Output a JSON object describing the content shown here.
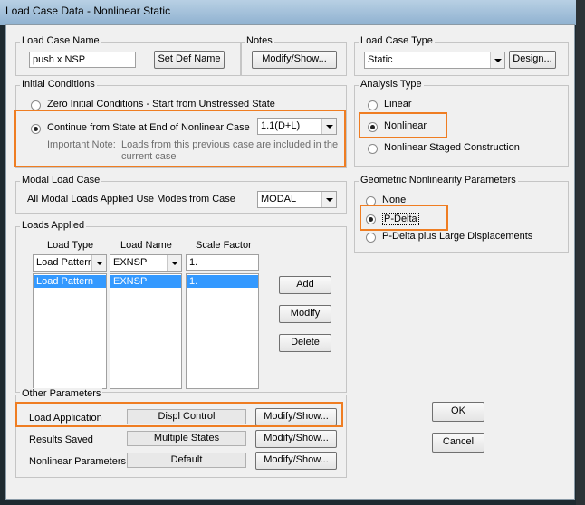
{
  "window": {
    "title": "Load Case Data - Nonlinear Static"
  },
  "load_case_name": {
    "label": "Load Case Name",
    "value": "push x NSP",
    "set_def_button": "Set Def Name"
  },
  "notes": {
    "label": "Notes",
    "button": "Modify/Show..."
  },
  "load_case_type": {
    "label": "Load Case Type",
    "value": "Static",
    "design_button": "Design..."
  },
  "initial_conditions": {
    "label": "Initial Conditions",
    "zero": "Zero Initial Conditions - Start from Unstressed State",
    "continue": "Continue from State at End of Nonlinear Case",
    "continue_case": "1.1(D+L)",
    "note_label": "Important Note:",
    "note_text_1": "Loads from this previous case are included in the",
    "note_text_2": "current case"
  },
  "analysis_type": {
    "label": "Analysis Type",
    "linear": "Linear",
    "nonlinear": "Nonlinear",
    "staged": "Nonlinear Staged Construction"
  },
  "modal_load_case": {
    "label": "Modal Load Case",
    "text": "All Modal Loads Applied Use Modes from Case",
    "value": "MODAL"
  },
  "geometric_nonlinearity": {
    "label": "Geometric Nonlinearity Parameters",
    "none": "None",
    "pdelta": "P-Delta",
    "pdelta_large": "P-Delta plus Large Displacements"
  },
  "loads_applied": {
    "label": "Loads Applied",
    "col_type": "Load Type",
    "col_name": "Load Name",
    "col_factor": "Scale Factor",
    "edit_type": "Load Pattern",
    "edit_name": "EXNSP",
    "edit_factor": "1.",
    "row_type": "Load Pattern",
    "row_name": "EXNSP",
    "row_factor": "1.",
    "add_button": "Add",
    "modify_button": "Modify",
    "delete_button": "Delete"
  },
  "other_parameters": {
    "label": "Other Parameters",
    "load_application": "Load Application",
    "load_application_value": "Displ Control",
    "results_saved": "Results Saved",
    "results_saved_value": "Multiple States",
    "nonlinear_parameters": "Nonlinear Parameters",
    "nonlinear_parameters_value": "Default",
    "modify_button": "Modify/Show..."
  },
  "buttons": {
    "ok": "OK",
    "cancel": "Cancel"
  },
  "colors": {
    "highlight": "#ef7d22",
    "selection": "#3399ff"
  }
}
